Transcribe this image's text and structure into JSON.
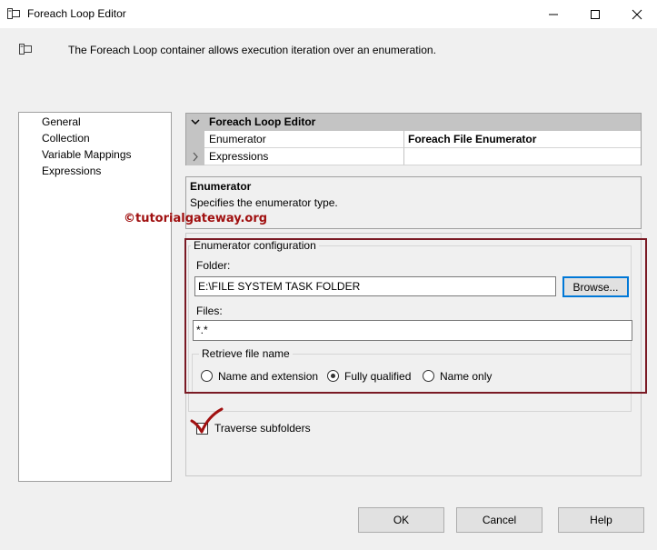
{
  "window": {
    "title": "Foreach Loop Editor",
    "minimize": "—",
    "maximize": "☐",
    "close": "✕"
  },
  "header": {
    "description": "The Foreach Loop container allows execution iteration over an enumeration."
  },
  "nav": {
    "items": [
      {
        "label": "General"
      },
      {
        "label": "Collection"
      },
      {
        "label": "Variable Mappings"
      },
      {
        "label": "Expressions"
      }
    ]
  },
  "property_grid": {
    "category": "Foreach Loop Editor",
    "rows": [
      {
        "name": "Enumerator",
        "value": "Foreach File Enumerator"
      },
      {
        "name": "Expressions",
        "value": ""
      }
    ]
  },
  "description_panel": {
    "title": "Enumerator",
    "text": "Specifies the enumerator type."
  },
  "watermark": "©tutorialgateway.org",
  "enumerator_config": {
    "legend": "Enumerator configuration",
    "folder_label": "Folder:",
    "folder_value": "E:\\FILE SYSTEM TASK FOLDER",
    "browse_label": "Browse...",
    "files_label": "Files:",
    "files_value": "*.*",
    "retrieve_legend": "Retrieve file name",
    "options": [
      {
        "label": "Name and extension",
        "selected": false
      },
      {
        "label": "Fully qualified",
        "selected": true
      },
      {
        "label": "Name only",
        "selected": false
      }
    ],
    "traverse_label": "Traverse subfolders",
    "traverse_checked": true
  },
  "footer": {
    "ok": "OK",
    "cancel": "Cancel",
    "help": "Help"
  },
  "colors": {
    "highlight": "#7a1a24",
    "watermark": "#a01010",
    "checkmark": "#a01010"
  }
}
